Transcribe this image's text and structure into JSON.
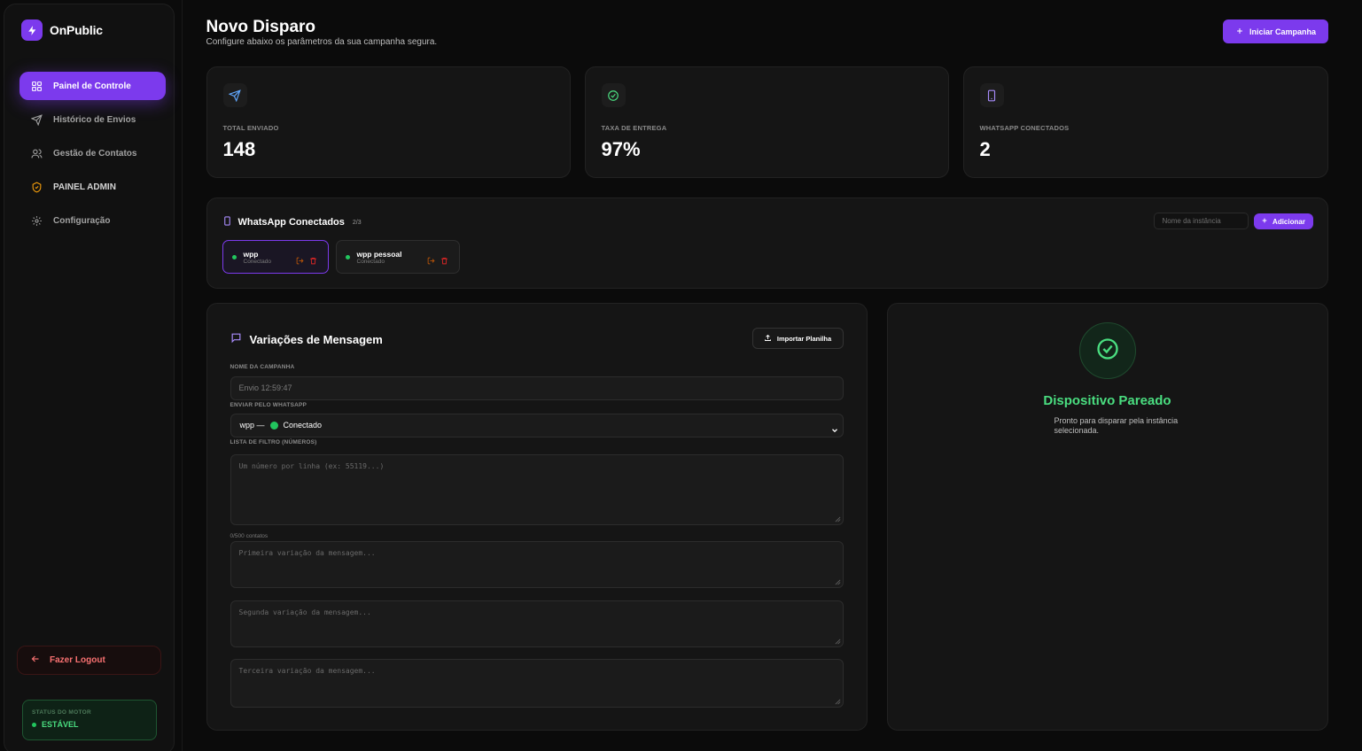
{
  "brand": {
    "name": "OnPublic",
    "accent": "#7c3aed"
  },
  "sidebar": {
    "items": [
      {
        "label": "Painel de Controle",
        "icon": "grid-icon",
        "active": true
      },
      {
        "label": "Histórico de Envios",
        "icon": "send-icon"
      },
      {
        "label": "Gestão de Contatos",
        "icon": "users-icon"
      },
      {
        "label": "PAINEL ADMIN",
        "icon": "shield-icon"
      },
      {
        "label": "Configuração",
        "icon": "gear-icon"
      }
    ],
    "logout_label": "Fazer Logout",
    "engine_status": {
      "label": "STATUS DO MOTOR",
      "value": "ESTÁVEL"
    }
  },
  "header": {
    "title": "Novo Disparo",
    "subtitle": "Configure abaixo os parâmetros da sua campanha segura.",
    "primary_button": "Iniciar Campanha"
  },
  "stats": [
    {
      "label": "TOTAL ENVIADO",
      "value": "148",
      "icon": "send-icon",
      "color": "#60a5fa"
    },
    {
      "label": "TAXA DE ENTREGA",
      "value": "97%",
      "icon": "check-circle-icon",
      "color": "#4ade80"
    },
    {
      "label": "WHATSAPP CONECTADOS",
      "value": "2",
      "icon": "phone-icon",
      "color": "#a78bfa"
    }
  ],
  "whatsapp": {
    "title": "WhatsApp Conectados",
    "count": "2/3",
    "instance_placeholder": "Nome da instância",
    "add_label": "Adicionar",
    "instances": [
      {
        "name": "wpp",
        "status": "Conectado",
        "selected": true
      },
      {
        "name": "wpp pessoal",
        "status": "Conectado",
        "selected": false
      }
    ]
  },
  "form": {
    "title": "Variações de Mensagem",
    "import_label": "Importar Planilha",
    "campaign_label": "NOME DA CAMPANHA",
    "campaign_value": "Envio 12:59:47",
    "whatsapp_label": "ENVIAR PELO WHATSAPP",
    "whatsapp_value_name": "wpp —",
    "whatsapp_value_status": "Conectado",
    "filter_label": "LISTA DE FILTRO (NÚMEROS)",
    "filter_placeholder": "Um número por linha (ex: 55119...)",
    "contacts_counter": "0/500 contatos",
    "variation_1_placeholder": "Primeira variação da mensagem...",
    "variation_2_placeholder": "Segunda variação da mensagem...",
    "variation_3_placeholder": "Terceira variação da mensagem..."
  },
  "device": {
    "title": "Dispositivo Pareado",
    "subtitle": "Pronto para disparar pela instância selecionada."
  }
}
